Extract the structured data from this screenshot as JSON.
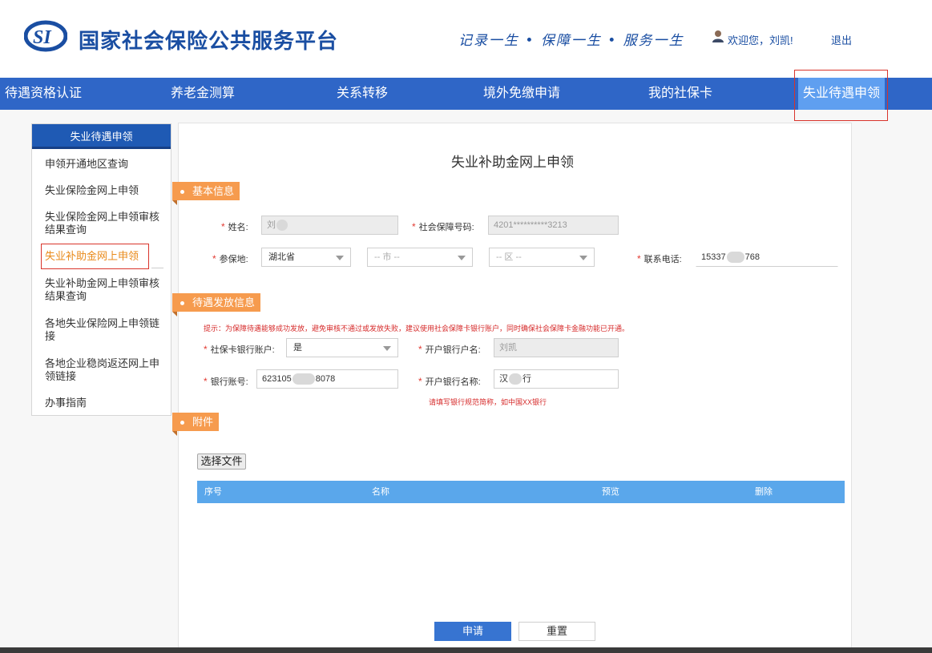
{
  "header": {
    "title": "国家社会保险公共服务平台",
    "slogan": "记录一生 • 保障一生 • 服务一生",
    "welcome": "欢迎您，刘凯!",
    "logout": "退出"
  },
  "nav": {
    "items": [
      {
        "label": "待遇资格认证"
      },
      {
        "label": "养老金测算"
      },
      {
        "label": "关系转移"
      },
      {
        "label": "境外免缴申请"
      },
      {
        "label": "我的社保卡"
      },
      {
        "label": "失业待遇申领"
      }
    ]
  },
  "sidebar": {
    "title": "失业待遇申领",
    "items": [
      {
        "label": "申领开通地区查询"
      },
      {
        "label": "失业保险金网上申领"
      },
      {
        "label": "失业保险金网上申领审核结果查询"
      },
      {
        "label": "失业补助金网上申领"
      },
      {
        "label": "失业补助金网上申领审核结果查询"
      },
      {
        "label": "各地失业保险网上申领链接"
      },
      {
        "label": "各地企业稳岗返还网上申领链接"
      },
      {
        "label": "办事指南"
      }
    ]
  },
  "page_title": "失业补助金网上申领",
  "sections": {
    "basic": "基本信息",
    "payment": "待遇发放信息",
    "attachment": "附件"
  },
  "form": {
    "name_label": "姓名:",
    "name_value": "刘",
    "ssn_label": "社会保障号码:",
    "ssn_value": "4201**********3213",
    "insured_label": "参保地:",
    "province": "湖北省",
    "city": "-- 市 --",
    "district": "-- 区 --",
    "phone_label": "联系电话:",
    "phone_prefix": "15337",
    "phone_suffix": "768",
    "tip": "提示：为保障待遇能够成功发放，避免审核不通过或发放失败，建议使用社会保障卡银行账户，同时确保社会保障卡金融功能已开通。",
    "card_account_label": "社保卡银行账户:",
    "card_account_value": "是",
    "bank_holder_label": "开户银行户名:",
    "bank_holder_value": "刘凯",
    "account_label": "银行账号:",
    "account_prefix": "623105",
    "account_suffix": "8078",
    "bank_name_label": "开户银行名称:",
    "bank_name_prefix": "汉",
    "bank_name_suffix": "行",
    "bank_tip": "请填写银行规范简称，如中国XX银行"
  },
  "attachment": {
    "choose_file": "选择文件",
    "columns": [
      "序号",
      "名称",
      "预览",
      "删除"
    ]
  },
  "actions": {
    "submit": "申请",
    "reset": "重置"
  }
}
